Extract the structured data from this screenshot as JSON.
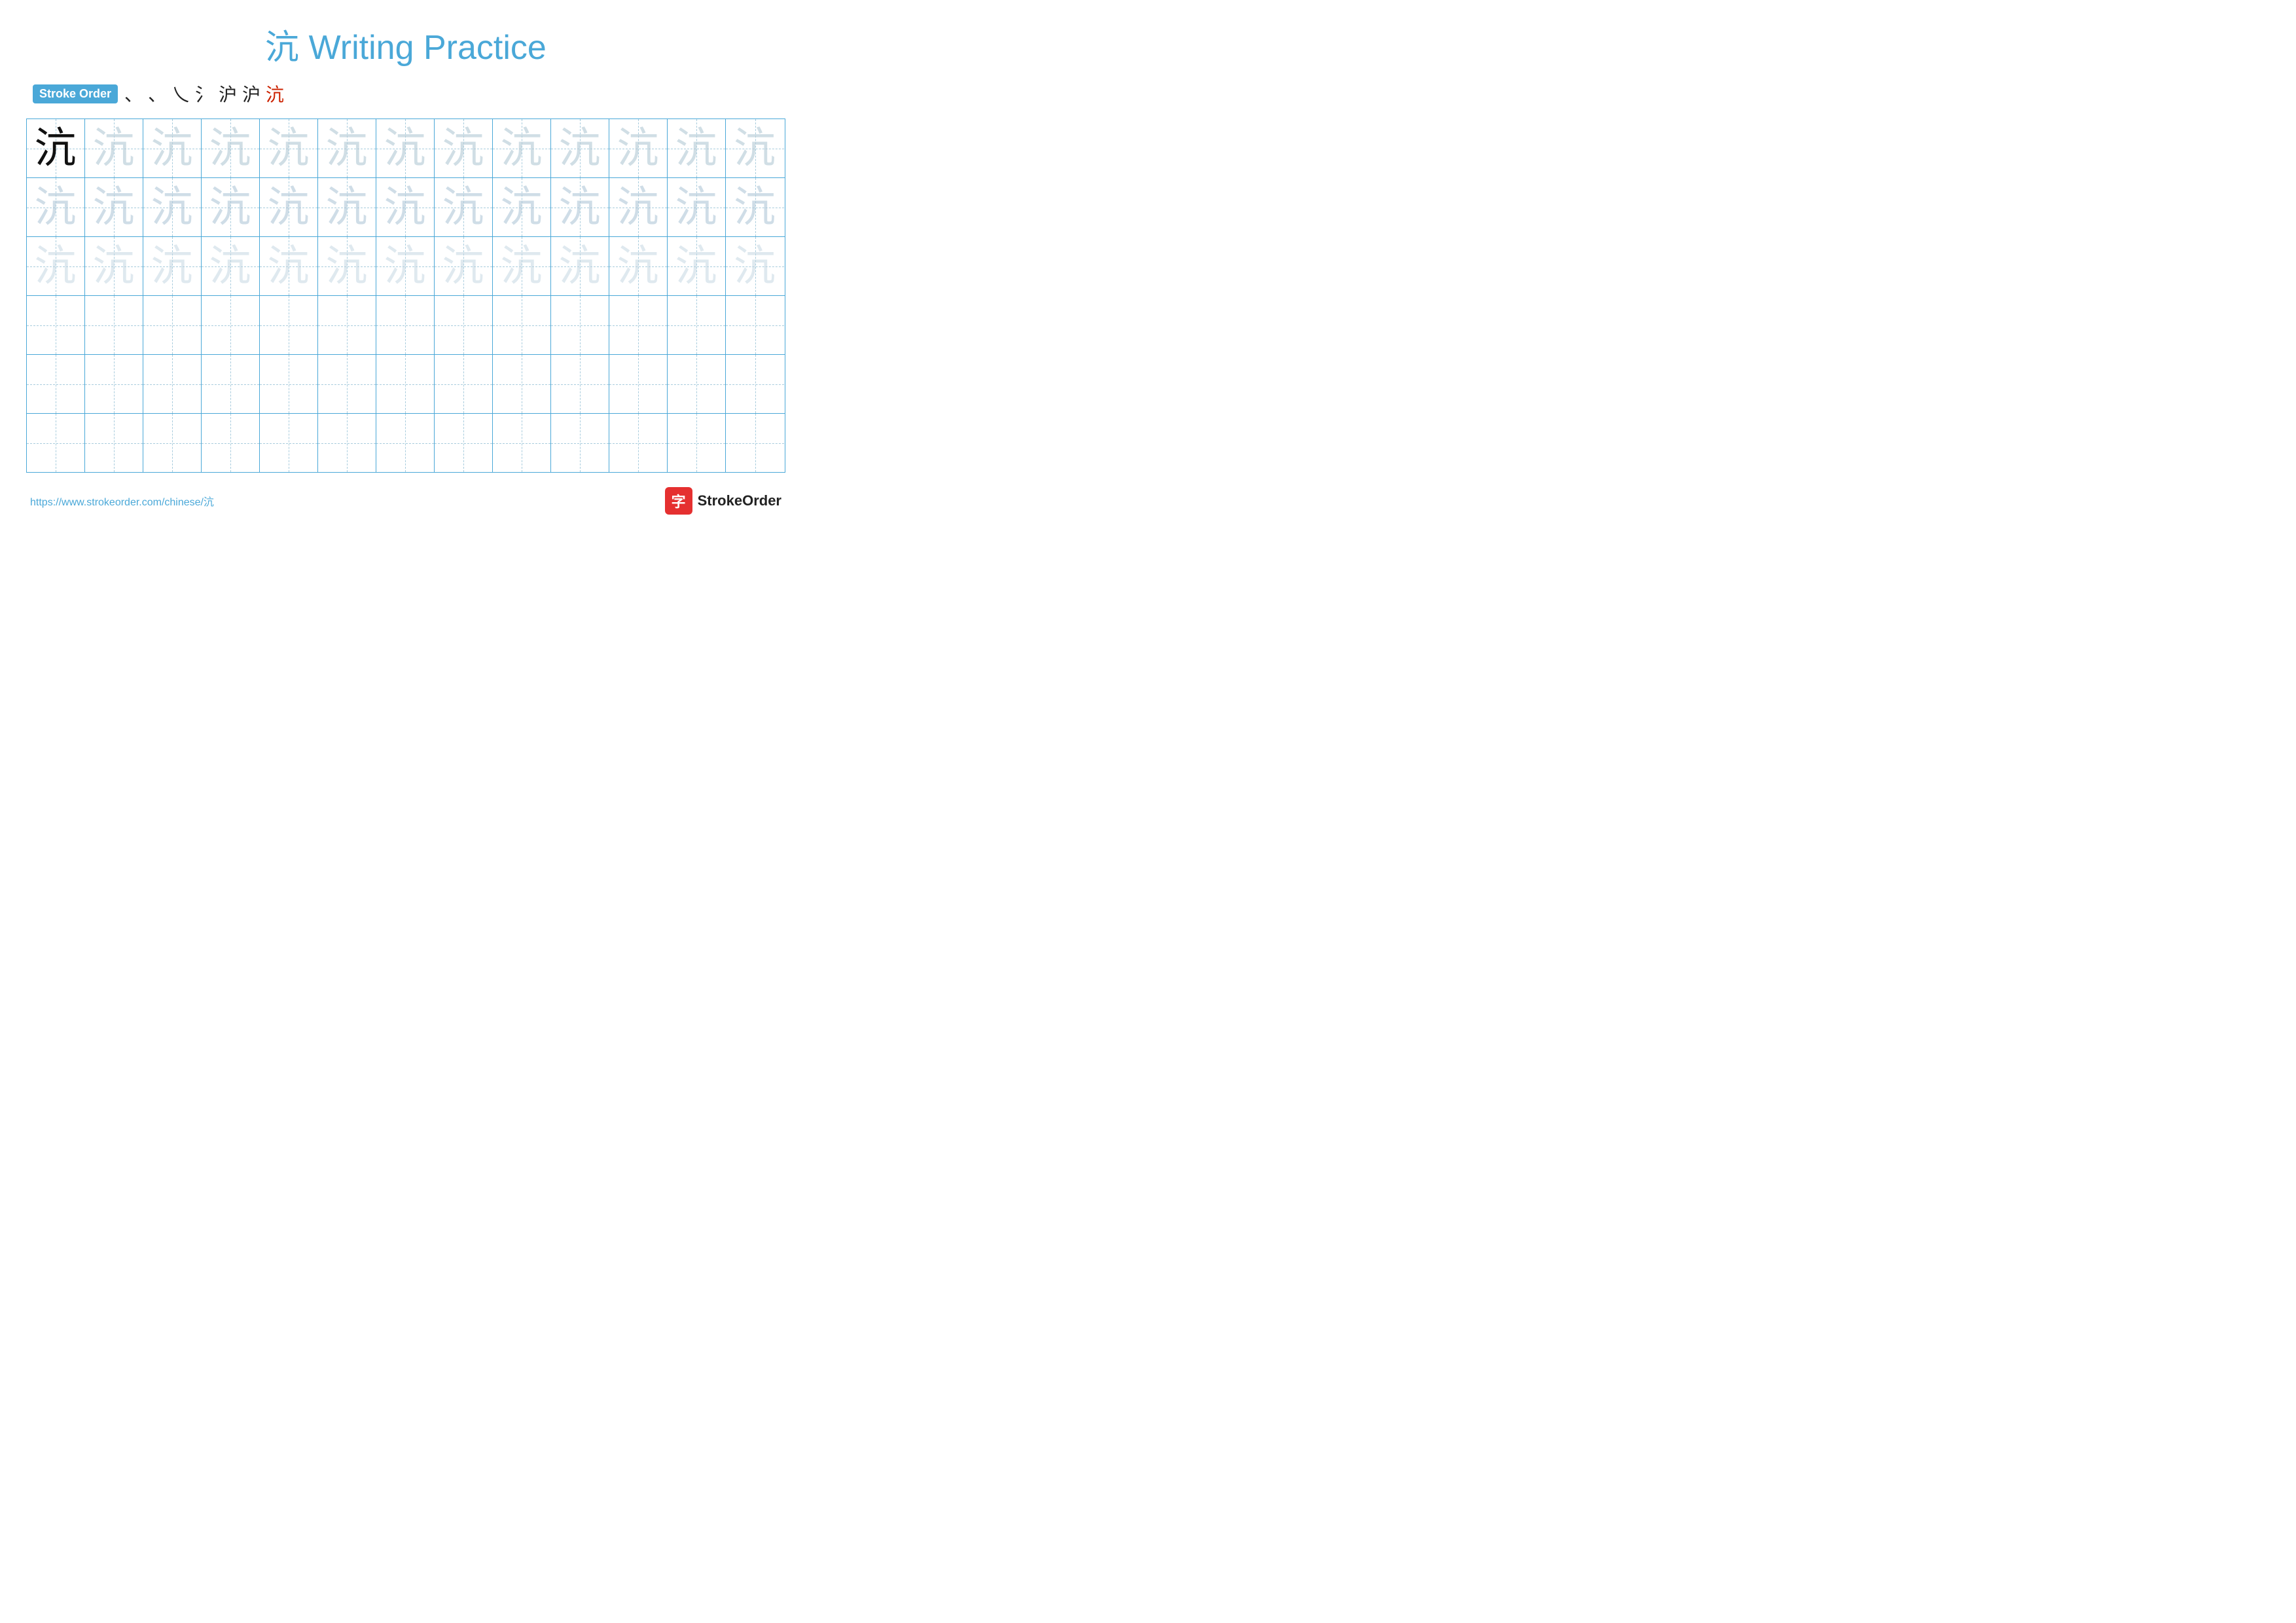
{
  "title": {
    "text": "沆 Writing Practice",
    "color": "#4aa8d8"
  },
  "stroke_order": {
    "badge_label": "Stroke Order",
    "strokes": [
      "、",
      "、",
      "乀",
      "氵",
      "沪",
      "沪",
      "沆"
    ]
  },
  "grid": {
    "cols": 13,
    "rows": [
      {
        "type": "dark_then_light",
        "chars": [
          "沆",
          "沆",
          "沆",
          "沆",
          "沆",
          "沆",
          "沆",
          "沆",
          "沆",
          "沆",
          "沆",
          "沆",
          "沆"
        ]
      },
      {
        "type": "light",
        "chars": [
          "沆",
          "沆",
          "沆",
          "沆",
          "沆",
          "沆",
          "沆",
          "沆",
          "沆",
          "沆",
          "沆",
          "沆",
          "沆"
        ]
      },
      {
        "type": "lighter",
        "chars": [
          "沆",
          "沆",
          "沆",
          "沆",
          "沆",
          "沆",
          "沆",
          "沆",
          "沆",
          "沆",
          "沆",
          "沆",
          "沆"
        ]
      },
      {
        "type": "empty",
        "chars": [
          "",
          "",
          "",
          "",
          "",
          "",
          "",
          "",
          "",
          "",
          "",
          "",
          ""
        ]
      },
      {
        "type": "empty",
        "chars": [
          "",
          "",
          "",
          "",
          "",
          "",
          "",
          "",
          "",
          "",
          "",
          "",
          ""
        ]
      },
      {
        "type": "empty",
        "chars": [
          "",
          "",
          "",
          "",
          "",
          "",
          "",
          "",
          "",
          "",
          "",
          "",
          ""
        ]
      }
    ]
  },
  "footer": {
    "url": "https://www.strokeorder.com/chinese/沆",
    "logo_icon": "字",
    "logo_text": "StrokeOrder"
  }
}
